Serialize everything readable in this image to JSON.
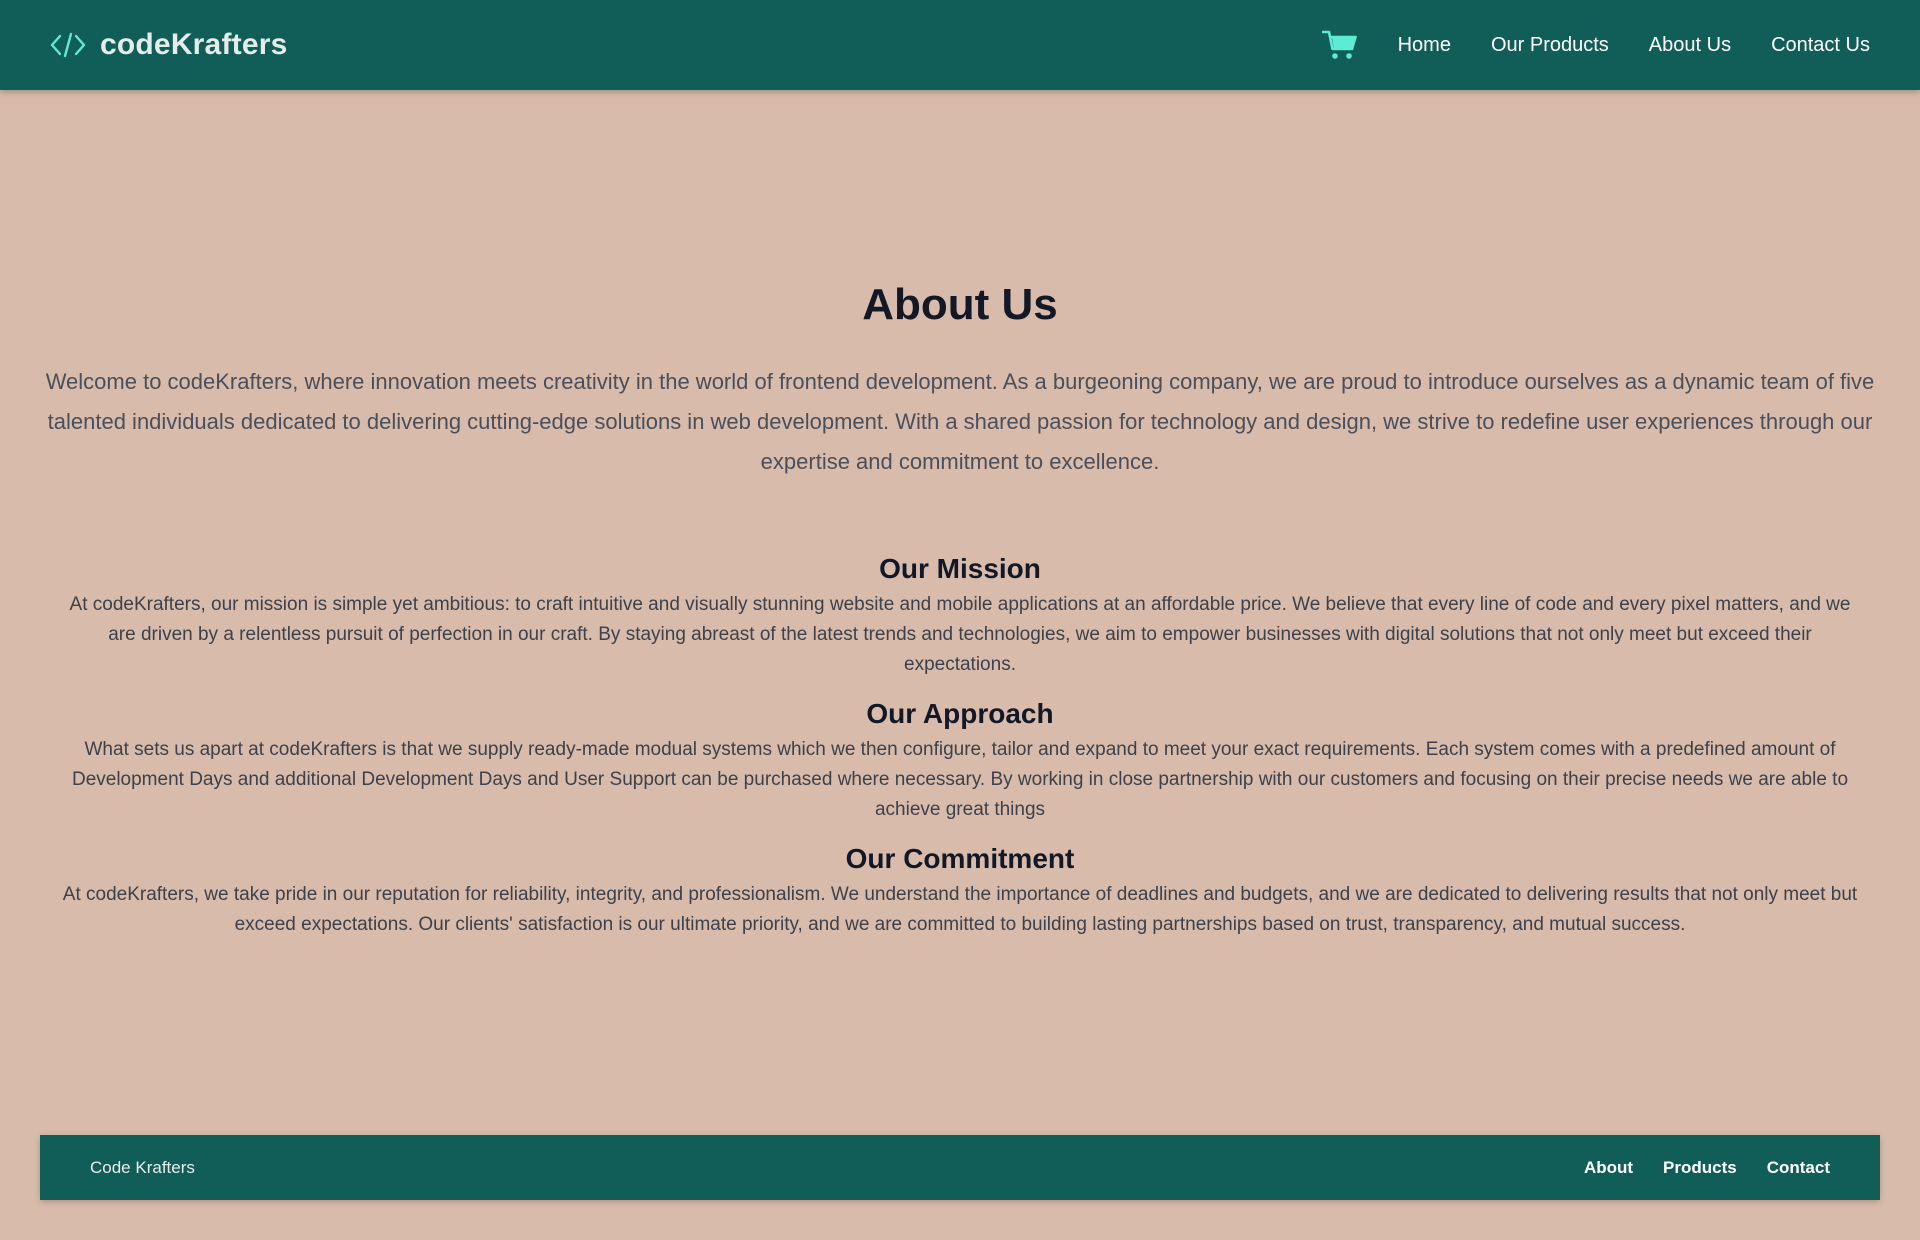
{
  "header": {
    "brand_name": "codeKrafters",
    "brand_icon": "code-brackets-icon",
    "cart_icon": "shopping-cart-icon",
    "nav": [
      {
        "label": "Home"
      },
      {
        "label": "Our Products"
      },
      {
        "label": "About Us"
      },
      {
        "label": "Contact Us"
      }
    ]
  },
  "main": {
    "title": "About Us",
    "intro": "Welcome to codeKrafters, where innovation meets creativity in the world of frontend development. As a burgeoning company, we are proud to introduce ourselves as a dynamic team of five talented individuals dedicated to delivering cutting-edge solutions in web development. With a shared passion for technology and design, we strive to redefine user experiences through our expertise and commitment to excellence.",
    "sections": [
      {
        "title": "Our Mission",
        "text": "At codeKrafters, our mission is simple yet ambitious: to craft intuitive and visually stunning website and mobile applications at an affordable price. We believe that every line of code and every pixel matters, and we are driven by a relentless pursuit of perfection in our craft. By staying abreast of the latest trends and technologies, we aim to empower businesses with digital solutions that not only meet but exceed their expectations."
      },
      {
        "title": "Our Approach",
        "text": "What sets us apart at codeKrafters is that we supply ready-made modual systems which we then configure, tailor and expand to meet your exact requirements. Each system comes with a predefined amount of Development Days and additional Development Days and User Support can be purchased where necessary. By working in close partnership with our customers and focusing on their precise needs we are able to achieve great things"
      },
      {
        "title": "Our Commitment",
        "text": "At codeKrafters, we take pride in our reputation for reliability, integrity, and professionalism. We understand the importance of deadlines and budgets, and we are dedicated to delivering results that not only meet but exceed expectations. Our clients' satisfaction is our ultimate priority, and we are committed to building lasting partnerships based on trust, transparency, and mutual success."
      }
    ]
  },
  "footer": {
    "brand": "Code Krafters",
    "links": [
      {
        "label": "About"
      },
      {
        "label": "Products"
      },
      {
        "label": "Contact"
      }
    ]
  },
  "colors": {
    "header_bg": "#115e59",
    "page_bg": "#d8bbaa",
    "accent_icon": "#5eead4",
    "heading_text": "#121826"
  }
}
